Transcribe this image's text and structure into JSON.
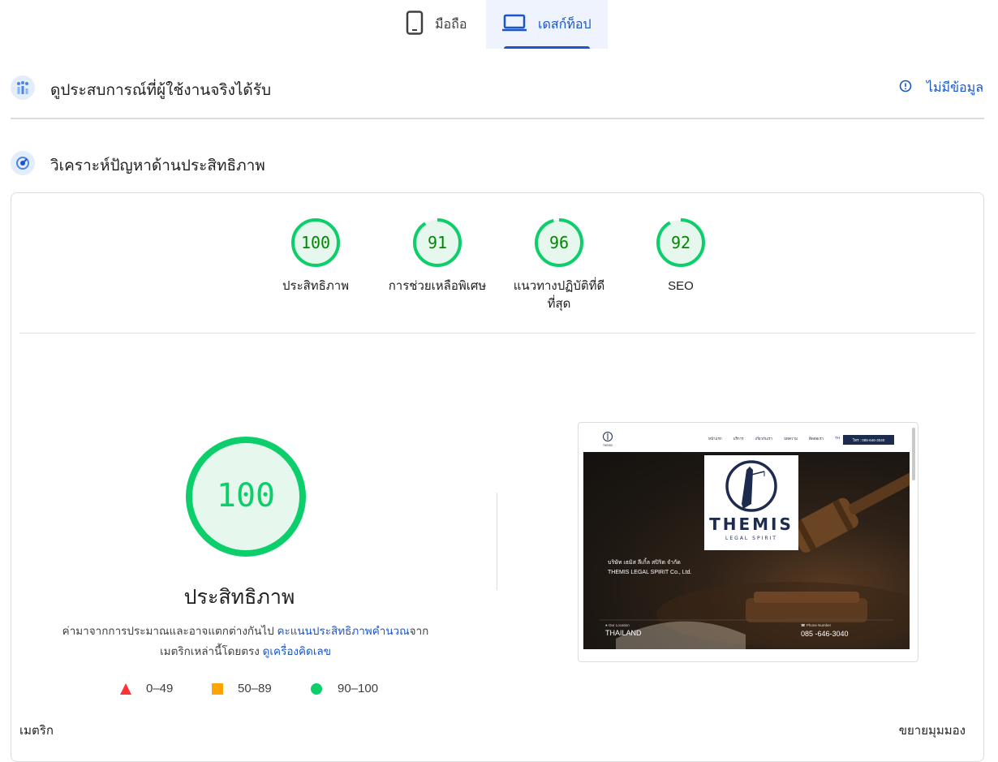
{
  "tabs": {
    "mobile_label": "มือถือ",
    "desktop_label": "เดสก์ท็อป"
  },
  "crux": {
    "title": "ดูประสบการณ์ที่ผู้ใช้งานจริงได้รับ",
    "no_data": "ไม่มีข้อมูล"
  },
  "diagnose": {
    "title": "วิเคราะห์ปัญหาด้านประสิทธิภาพ"
  },
  "scores": [
    {
      "value": "100",
      "label": "ประสิทธิภาพ",
      "fraction": 1.0
    },
    {
      "value": "91",
      "label": "การช่วยเหลือพิเศษ",
      "fraction": 0.91
    },
    {
      "value": "96",
      "label": "แนวทางปฏิบัติที่ดีที่สุด",
      "fraction": 0.96
    },
    {
      "value": "92",
      "label": "SEO",
      "fraction": 0.92
    }
  ],
  "performance": {
    "score": "100",
    "fraction": 1.0,
    "title": "ประสิทธิภาพ",
    "desc_part1": "ค่ามาจากการประมาณและอาจแตกต่างกันไป ",
    "desc_link1": "คะแนนประสิทธิภาพคำนวณ",
    "desc_part2": "จากเมตริกเหล่านี้โดยตรง ",
    "desc_link2": "ดูเครื่องคิดเลข"
  },
  "legend": {
    "fail": "0–49",
    "average": "50–89",
    "pass": "90–100"
  },
  "footer": {
    "metrics_label": "เมตริก",
    "expand_label": "ขยายมุมมอง"
  },
  "screenshot": {
    "nav_items": [
      "หน้าแรก",
      "บริการ",
      "เกี่ยวกับเรา",
      "บทความ",
      "ติดต่อเรา",
      "TH"
    ],
    "nav_button": "โทร : 085-646-3040",
    "logo_mark": "THEMIS",
    "logo_big": "THEMIS",
    "logo_sub": "LEGAL SPIRIT",
    "company_th": "บริษัท เธมิส ลีเกิ้ล สปิริต จำกัด",
    "company_en": "THEMIS LEGAL SPIRIT Co., Ltd.",
    "location_label": "Our Location",
    "location_value": "THAILAND",
    "phone_label": "Phone Number",
    "phone_value": "085 -646-3040"
  },
  "colors": {
    "pass": "#0cce6b",
    "pass_bg": "#e6f8ee",
    "pass_text": "#008800",
    "average": "#ffa400",
    "fail": "#ff3333",
    "link": "#1a56c9"
  },
  "icons": {
    "mobile": "phone-icon",
    "desktop": "laptop-icon",
    "crux": "people-chart-icon",
    "diagnose": "speedometer-icon",
    "info": "info-icon"
  }
}
